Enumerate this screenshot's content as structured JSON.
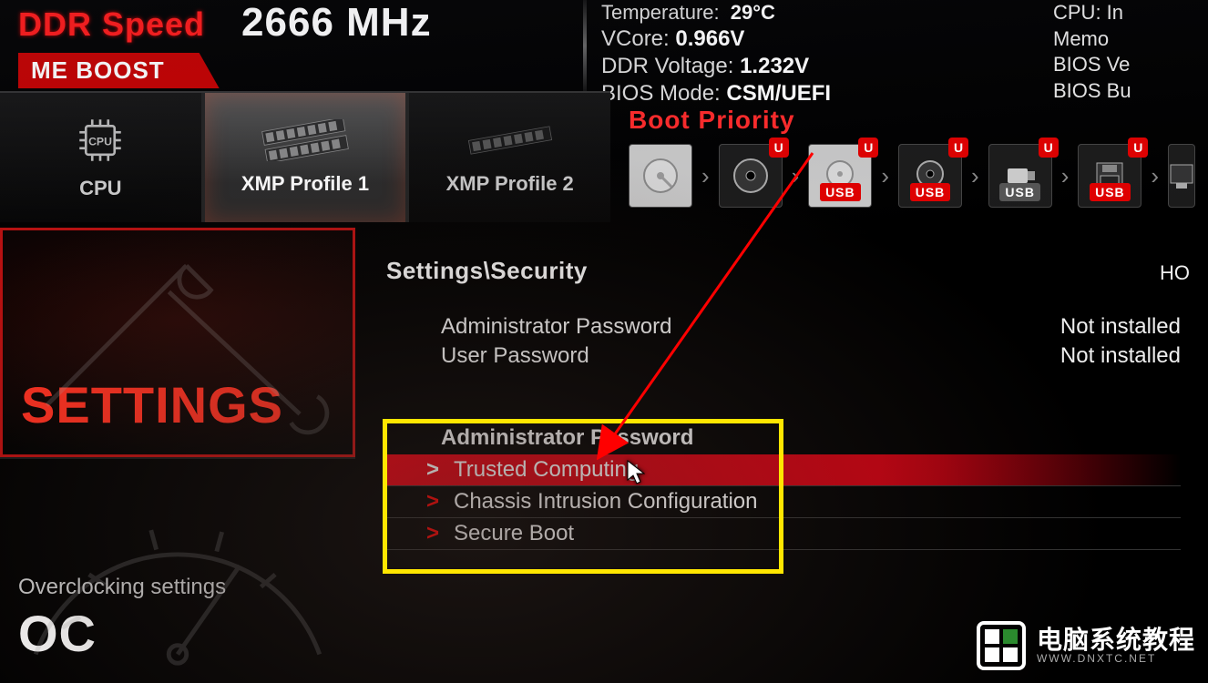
{
  "header": {
    "ddr_label": "DDR Speed",
    "ddr_value": "2666 MHz",
    "game_boost": "ME BOOST",
    "temperature_label": "Temperature:",
    "temperature_value": "29°C",
    "vcore_label": "VCore:",
    "vcore_value": "0.966V",
    "ddr_voltage_label": "DDR Voltage:",
    "ddr_voltage_value": "1.232V",
    "bios_mode_label": "BIOS Mode:",
    "bios_mode_value": "CSM/UEFI",
    "right": {
      "cpu": "CPU: In",
      "memory": "Memo",
      "bios_ver": "BIOS Ve",
      "bios_build": "BIOS Bu"
    }
  },
  "profiles": {
    "cpu": "CPU",
    "xmp1": "XMP Profile 1",
    "xmp2": "XMP Profile 2"
  },
  "boot": {
    "title": "Boot Priority",
    "usb_tag": "USB",
    "corner": "U"
  },
  "sidebar": {
    "settings": "SETTINGS",
    "oc_small": "Overclocking settings",
    "oc_big": "OC"
  },
  "main": {
    "breadcrumb": "Settings\\Security",
    "help_right": "HO",
    "rows": [
      {
        "label": "Administrator Password",
        "value": "Not installed"
      },
      {
        "label": "User Password",
        "value": "Not installed"
      }
    ],
    "section_heading": "Administrator Password",
    "menu": [
      "Trusted Computing",
      "Chassis Intrusion Configuration",
      "Secure Boot"
    ]
  },
  "watermark": {
    "line1": "电脑系统教程",
    "line2": "WWW.DNXTC.NET"
  }
}
